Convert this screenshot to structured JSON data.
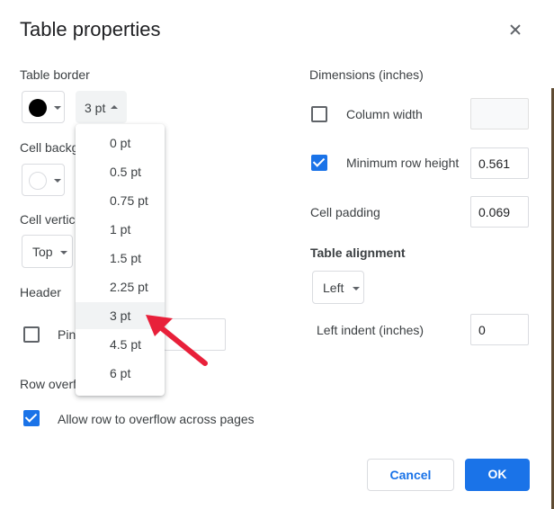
{
  "dialog": {
    "title": "Table properties"
  },
  "left": {
    "table_border": {
      "label": "Table border",
      "color": "#000000",
      "width_value": "3 pt"
    },
    "cell_background": {
      "label": "Cell backg",
      "color": "#ffffff"
    },
    "cell_vertical": {
      "label": "Cell vertic",
      "value": "Top"
    },
    "header": {
      "label": "Header",
      "pin_label": "Pin"
    },
    "row_overflow": {
      "label": "Row overf",
      "checkbox_label": "Allow row to overflow across pages",
      "checked": true
    }
  },
  "border_width_menu": {
    "options": [
      "0 pt",
      "0.5 pt",
      "0.75 pt",
      "1 pt",
      "1.5 pt",
      "2.25 pt",
      "3 pt",
      "4.5 pt",
      "6 pt"
    ],
    "highlighted": "3 pt"
  },
  "right": {
    "dimensions": {
      "label": "Dimensions  (inches)"
    },
    "column_width": {
      "label": "Column width",
      "checked": false,
      "value": ""
    },
    "min_row_height": {
      "label": "Minimum row height",
      "checked": true,
      "value": "0.561"
    },
    "cell_padding": {
      "label": "Cell padding",
      "value": "0.069"
    },
    "table_alignment": {
      "label": "Table alignment",
      "value": "Left"
    },
    "left_indent": {
      "label": "Left indent  (inches)",
      "value": "0"
    }
  },
  "footer": {
    "cancel_label": "Cancel",
    "ok_label": "OK"
  },
  "colors": {
    "accent": "#1a73e8",
    "annotation_arrow": "#e8203a"
  }
}
